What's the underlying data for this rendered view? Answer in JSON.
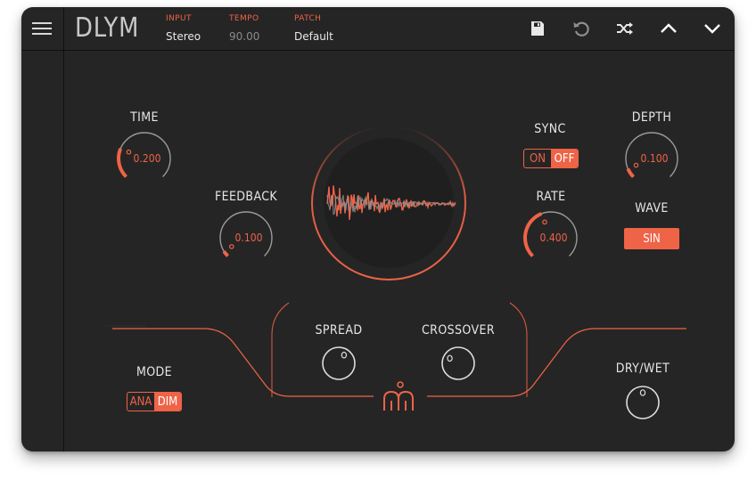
{
  "header": {
    "menu_icon": "hamburger-menu-icon",
    "app_title": "DLYM",
    "input": {
      "label": "INPUT",
      "value": "Stereo"
    },
    "tempo": {
      "label": "TEMPO",
      "value": "90.00"
    },
    "patch": {
      "label": "PATCH",
      "value": "Default"
    },
    "toolbar_icons": [
      "save-icon",
      "undo-icon",
      "shuffle-icon",
      "chevron-up-icon",
      "chevron-down-icon"
    ]
  },
  "controls": {
    "time": {
      "label": "TIME",
      "value": "0.200",
      "level": 0.25
    },
    "feedback": {
      "label": "FEEDBACK",
      "value": "0.100",
      "level": 0.05
    },
    "sync": {
      "label": "SYNC",
      "on": "ON",
      "off": "OFF",
      "selected": "OFF"
    },
    "rate": {
      "label": "RATE",
      "value": "0.400",
      "level": 0.42
    },
    "depth": {
      "label": "DEPTH",
      "value": "0.100",
      "level": 0.08
    },
    "wave": {
      "label": "WAVE",
      "value": "SIN"
    },
    "mode": {
      "label": "MODE",
      "options": [
        "ANA",
        "DIM"
      ],
      "selected": "DIM"
    },
    "spread": {
      "label": "SPREAD",
      "level": 0.62
    },
    "crossover": {
      "label": "CROSSOVER",
      "level": 0.28
    },
    "drywet": {
      "label": "DRY/WET",
      "level": 0.5
    }
  },
  "display": {
    "type": "waveform",
    "logo": "m-logo-icon"
  },
  "colors": {
    "accent": "#ef6347",
    "panel": "#252525",
    "text": "#e6e6e6",
    "knob_track": "#9a9a9a"
  }
}
